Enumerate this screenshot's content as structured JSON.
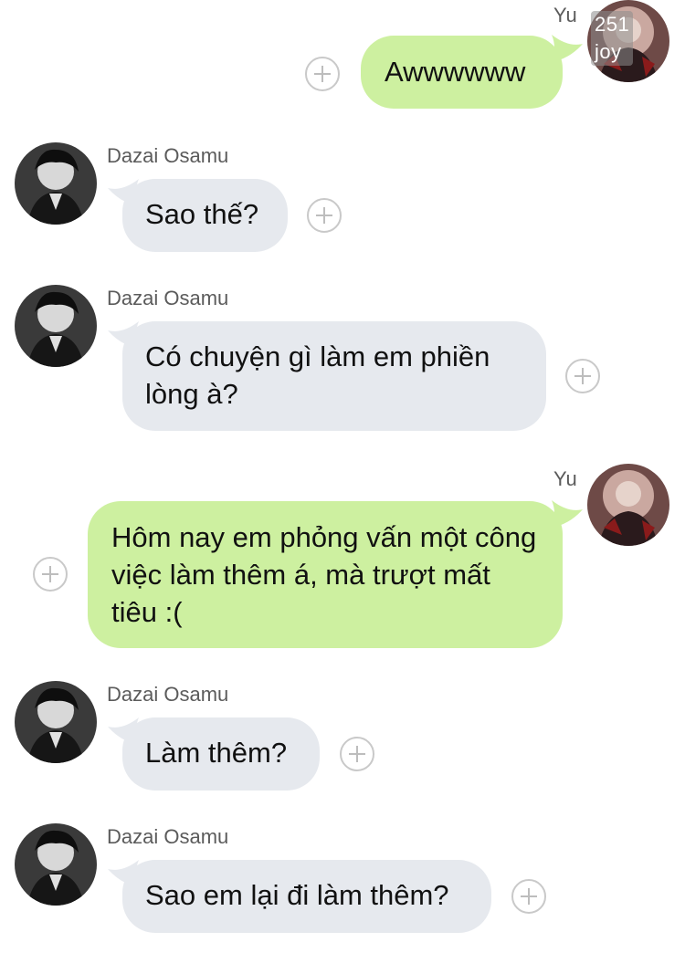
{
  "app": {
    "colors": {
      "incoming_bubble": "#e6e9ee",
      "outgoing_bubble": "#cdf0a0",
      "sender_name": "#5b5b5b",
      "plus_icon": "#c9c9c9"
    }
  },
  "watermark": "251 joy",
  "messages": [
    {
      "sender": "Yu",
      "direction": "outgoing",
      "text": "Awwwwww",
      "avatar": "yu-avatar"
    },
    {
      "sender": "Dazai Osamu",
      "direction": "incoming",
      "text": "Sao thế?",
      "avatar": "dazai-avatar"
    },
    {
      "sender": "Dazai Osamu",
      "direction": "incoming",
      "text": "Có chuyện gì làm em phiền lòng à?",
      "avatar": "dazai-avatar"
    },
    {
      "sender": "Yu",
      "direction": "outgoing",
      "text": "Hôm nay em phỏng vấn một công việc làm thêm á, mà trượt mất tiêu :(",
      "avatar": "yu-avatar"
    },
    {
      "sender": "Dazai Osamu",
      "direction": "incoming",
      "text": "Làm thêm?",
      "avatar": "dazai-avatar"
    },
    {
      "sender": "Dazai Osamu",
      "direction": "incoming",
      "text": "Sao em lại đi làm thêm?",
      "avatar": "dazai-avatar"
    }
  ],
  "icons": {
    "add_reaction": "plus-circle-icon"
  }
}
